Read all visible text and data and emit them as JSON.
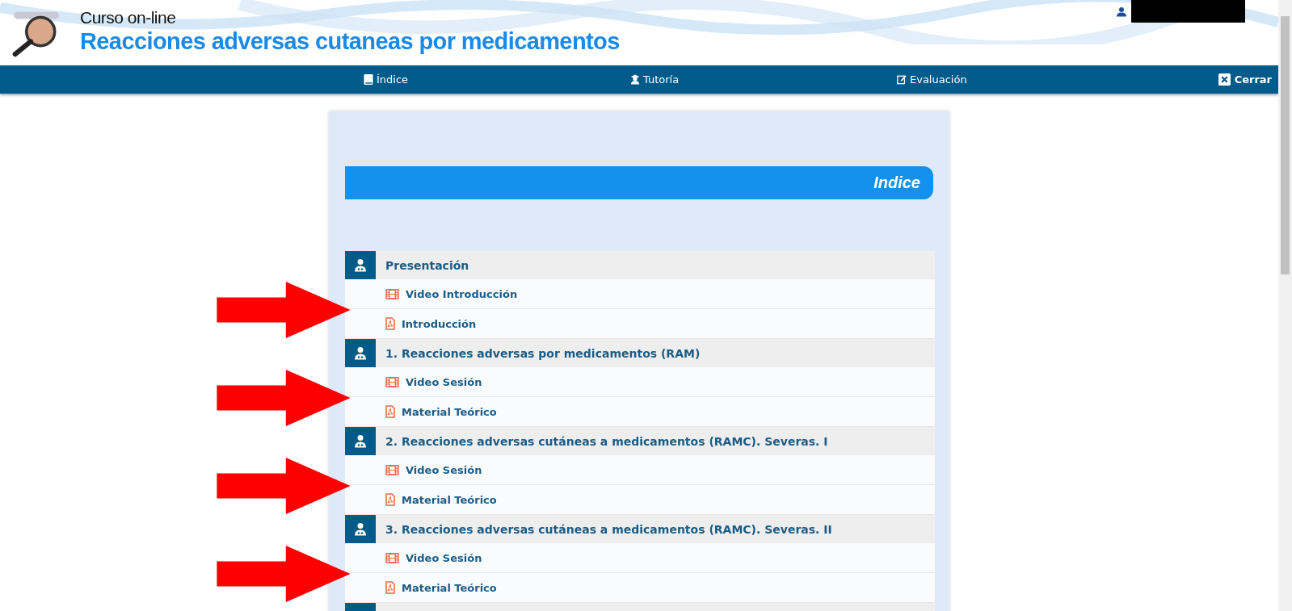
{
  "header": {
    "subtitle": "Curso on-line",
    "title": "Reacciones adversas cutaneas por medicamentos"
  },
  "nav": [
    {
      "label": "Índice"
    },
    {
      "label": "Tutoría"
    },
    {
      "label": "Evaluación"
    }
  ],
  "close_button": "Cerrar",
  "index_title": "Indice",
  "sections": [
    {
      "title": "Presentación",
      "items": [
        {
          "kind": "video",
          "label": "Video Introducción"
        },
        {
          "kind": "pdf",
          "label": "Introducción"
        }
      ]
    },
    {
      "title": "1. Reacciones adversas por medicamentos (RAM)",
      "items": [
        {
          "kind": "video",
          "label": "Video Sesión"
        },
        {
          "kind": "pdf",
          "label": "Material Teórico"
        }
      ]
    },
    {
      "title": "2. Reacciones adversas cutáneas a medicamentos (RAMC). Severas. I",
      "items": [
        {
          "kind": "video",
          "label": "Video Sesión"
        },
        {
          "kind": "pdf",
          "label": "Material Teórico"
        }
      ]
    },
    {
      "title": "3. Reacciones adversas cutáneas a medicamentos (RAMC). Severas. II",
      "items": [
        {
          "kind": "video",
          "label": "Video Sesión"
        },
        {
          "kind": "pdf",
          "label": "Material Teórico"
        }
      ]
    }
  ]
}
